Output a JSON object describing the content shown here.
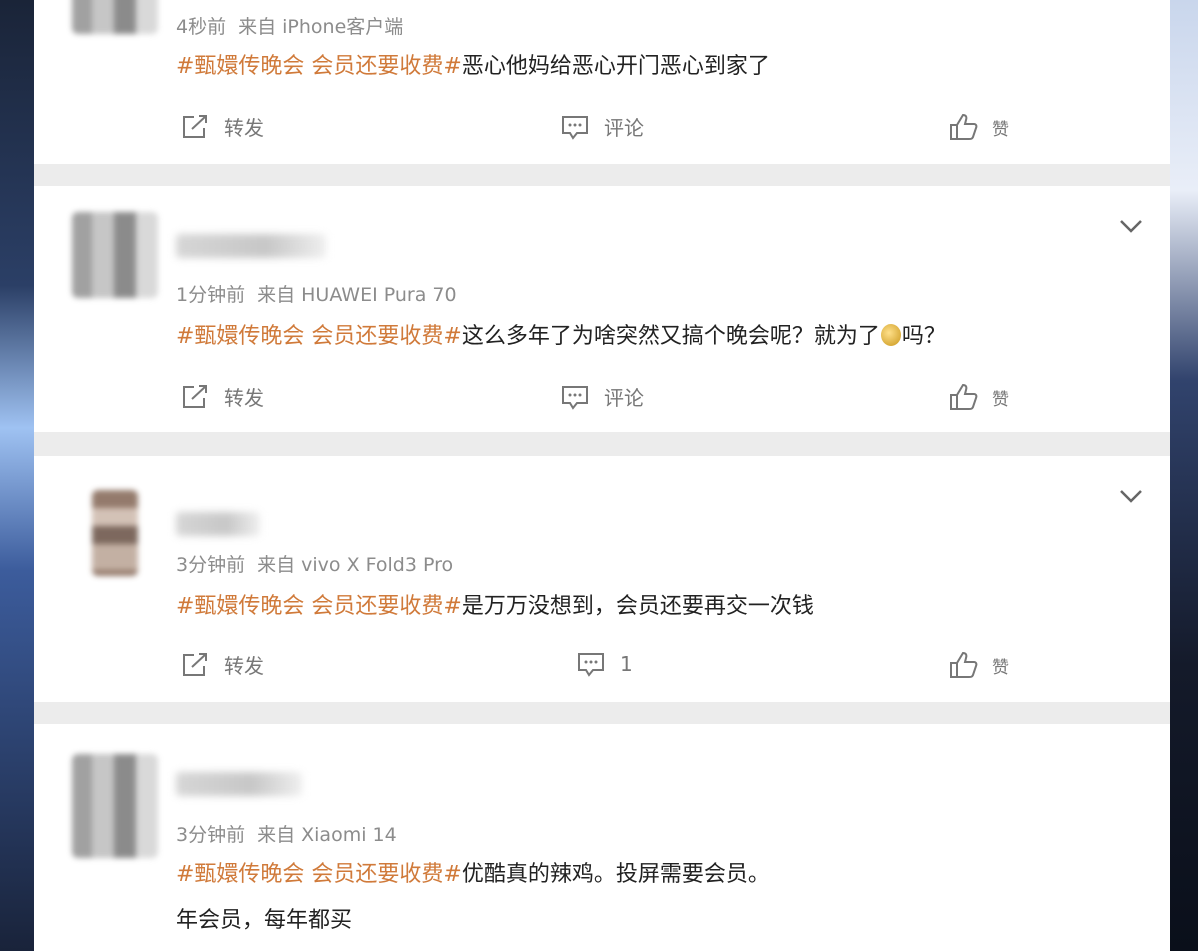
{
  "actions": {
    "repost_label": "转发",
    "comment_label": "评论",
    "like_label": "赞"
  },
  "posts": [
    {
      "time": "4秒前",
      "source": "来自 iPhone客户端",
      "tag": "#甄嬛传晚会 会员还要收费#",
      "text": "恶心他妈给恶心开门恶心到家了",
      "comment_count": "评论"
    },
    {
      "time": "1分钟前",
      "source": "来自 HUAWEI Pura 70",
      "tag": "#甄嬛传晚会 会员还要收费#",
      "text_before": "这么多年了为啥突然又搞个晚会呢？就为了",
      "text_after": "吗？",
      "comment_count": "评论"
    },
    {
      "time": "3分钟前",
      "source": "来自 vivo X Fold3 Pro",
      "tag": "#甄嬛传晚会 会员还要收费#",
      "text": "是万万没想到，会员还要再交一次钱",
      "comment_count": "1"
    },
    {
      "time": "3分钟前",
      "source": "来自 Xiaomi 14",
      "tag": "#甄嬛传晚会 会员还要收费#",
      "text": "优酷真的辣鸡。投屏需要会员。",
      "text_line2": "年会员，每年都买"
    }
  ]
}
